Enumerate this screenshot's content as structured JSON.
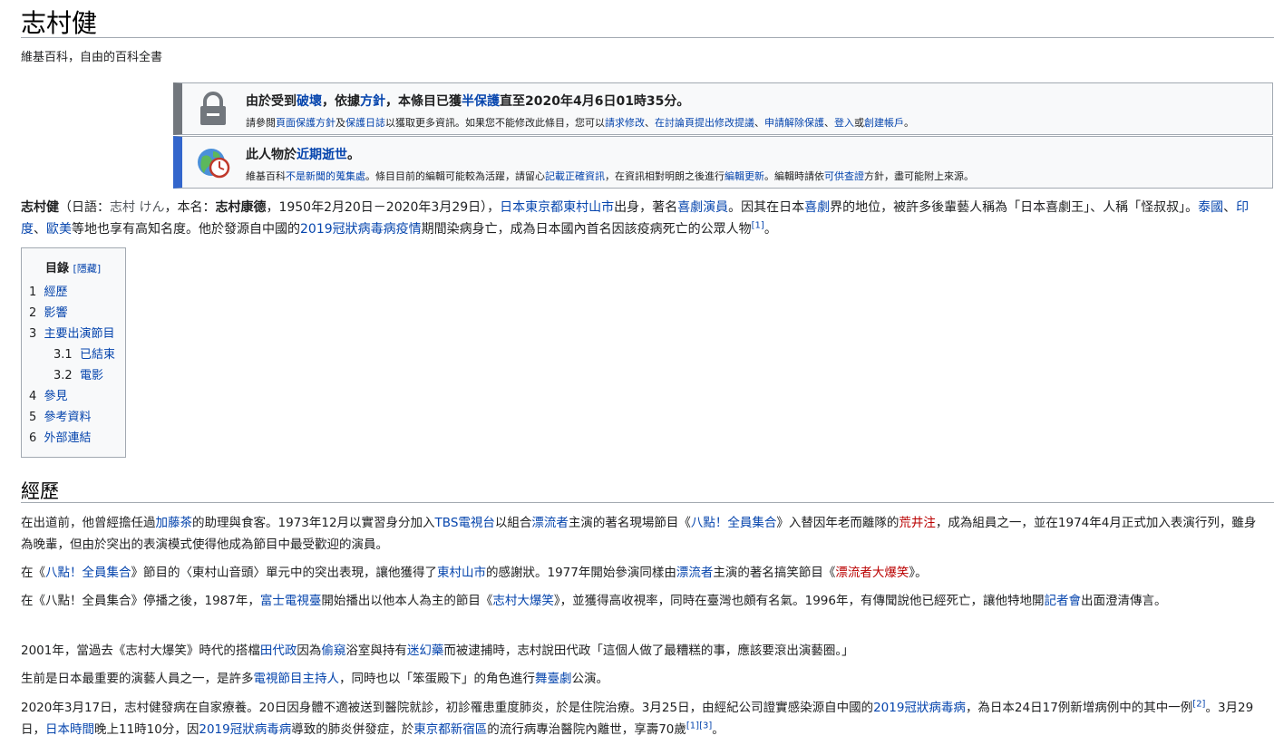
{
  "title": "志村健",
  "tagline": "維基百科，自由的百科全書",
  "protect_box": {
    "l1_a": "由於受到",
    "l1_b": "破壞",
    "l1_c": "，依據",
    "l1_d": "方針",
    "l1_e": "，本條目已獲",
    "l1_f": "半保護",
    "l1_g": "直至2020年4月6日01時35分。",
    "l2_a": "請參閱",
    "l2_b": "頁面保護方針",
    "l2_c": "及",
    "l2_d": "保護日誌",
    "l2_e": "以獲取更多資訊。如果您不能修改此條目，您可以",
    "l2_f": "請求修改",
    "l2_g": "、",
    "l2_h": "在討論頁提出修改提議",
    "l2_i": "申請解除保護",
    "l2_j": "登入",
    "l2_k": "或",
    "l2_l": "創建帳戶",
    "l2_m": "。"
  },
  "death_box": {
    "l1_a": "此人物於",
    "l1_b": "近期逝世",
    "l1_c": "。",
    "l2_a": "維基百科",
    "l2_b": "不是新聞的蒐集處",
    "l2_c": "。條目目前的編輯可能較為活躍，請留心",
    "l2_d": "記載正確資訊",
    "l2_e": "，在資訊相對明朗之後進行",
    "l2_f": "編輯更新",
    "l2_g": "。編輯時請依",
    "l2_h": "可供查證",
    "l2_i": "方針，盡可能附上來源。"
  },
  "intro": {
    "s1": "志村健",
    "s2": "（日語：",
    "s3": "志村 けん",
    "s4": "，本名：",
    "s5": "志村康德",
    "s6": "，1950年2月20日－2020年3月29日），",
    "s7": "日本東京都東村山市",
    "s8": "出身，著名",
    "s9": "喜劇演員",
    "s10": "。因其在日本",
    "s11": "喜劇",
    "s12": "界的地位，被許多後輩藝人稱為「日本喜劇王」、人稱「怪叔叔」。",
    "s13": "泰國",
    "s14": "、",
    "s15": "印度",
    "s16": "、",
    "s17": "歐美",
    "s18": "等地也享有高知名度。他於發源自中國的",
    "s19": "2019冠狀病毒病疫情",
    "s20": "期間染病身亡，成為日本國內首名因該疫病死亡的公眾人物",
    "s21": "[1]",
    "s22": "。"
  },
  "toc": {
    "title": "目錄",
    "hide": "[隱藏]",
    "items": [
      {
        "num": "1",
        "label": "經歷"
      },
      {
        "num": "2",
        "label": "影響"
      },
      {
        "num": "3",
        "label": "主要出演節目"
      },
      {
        "num": "3.1",
        "label": "已結束"
      },
      {
        "num": "3.2",
        "label": "電影"
      },
      {
        "num": "4",
        "label": "參見"
      },
      {
        "num": "5",
        "label": "參考資料"
      },
      {
        "num": "6",
        "label": "外部連結"
      }
    ]
  },
  "section": {
    "heading": "經歷"
  },
  "body": {
    "p1": {
      "a": "在出道前，他曾經擔任過",
      "b": "加藤茶",
      "c": "的助理與食客。1973年12月以實習身分加入",
      "d": "TBS電視台",
      "e": "以組合",
      "f": "漂流者",
      "g": "主演的著名現場節目《",
      "h": "八點！全員集合",
      "i": "》入替因年老而離隊的",
      "j": "荒井注",
      "k": "，成為組員之一，並在1974年4月正式加入表演行列，雖身為晚輩，但由於突出的表演模式使得他成為節目中最受歡迎的演員。"
    },
    "p2": {
      "a": "在《",
      "b": "八點！全員集合",
      "c": "》節目的〈東村山音頭〉單元中的突出表現，讓他獲得了",
      "d": "東村山市",
      "e": "的感謝狀。1977年開始參演同樣由",
      "f": "漂流者",
      "g": "主演的著名搞笑節目《",
      "h": "漂流者大爆笑",
      "i": "》。"
    },
    "p3": {
      "a": "在《八點！全員集合》停播之後，1987年，",
      "b": "富士電視臺",
      "c": "開始播出以他本人為主的節目《",
      "d": "志村大爆笑",
      "e": "》，並獲得高收視率，同時在臺灣也頗有名氣。1996年，有傳聞說他已經死亡，讓他特地開",
      "f": "記者會",
      "g": "出面澄清傳言。"
    },
    "p4": {
      "a": "2001年，當過去《志村大爆笑》時代的搭檔",
      "b": "田代政",
      "c": "因為",
      "d": "偷窺",
      "e": "浴室與持有",
      "f": "迷幻藥",
      "g": "而被逮捕時，志村說田代政「這個人做了最糟糕的事，應該要滾出演藝圈。」"
    },
    "p5": {
      "a": "生前是日本最重要的演藝人員之一，是許多",
      "b": "電視節目主持人",
      "c": "，同時也以「笨蛋殿下」的角色進行",
      "d": "舞臺劇",
      "e": "公演。"
    },
    "p6": {
      "a": "2020年3月17日，志村健發病在自家療養。20日因身體不適被送到醫院就診，初診罹患重度肺炎，於是住院治療。3月25日，由經紀公司證實感染源自中國的",
      "b": "2019冠狀病毒病",
      "c": "，為日本24日17例新增病例中的其中一例",
      "d": "[2]",
      "e": "。3月29日，",
      "f": "日本時間",
      "g": "晚上11時10分，因",
      "h": "2019冠狀病毒病",
      "i": "導致的肺炎併發症，於",
      "j": "東京都",
      "k": "新宿區",
      "l": "的流行病專治醫院內離世，享壽70歲",
      "m": "[1][3]",
      "n": "。"
    }
  }
}
